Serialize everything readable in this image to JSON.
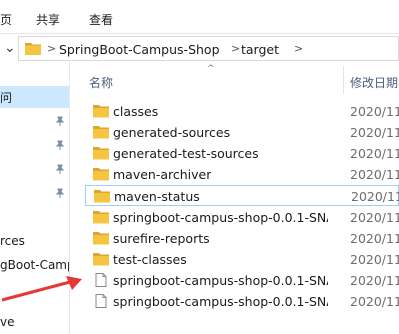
{
  "ribbon": {
    "tabs": [
      "页",
      "共享",
      "查看"
    ]
  },
  "address": {
    "crumbs": [
      "SpringBoot-Campus-Shop",
      "target"
    ]
  },
  "columns": {
    "name": "名称",
    "date": "修改日期"
  },
  "nav": {
    "items": [
      {
        "label": "问",
        "selected": true
      },
      {
        "label": "rces",
        "selected": false
      },
      {
        "label": "gBoot-Camp",
        "selected": false
      },
      {
        "label": "ve",
        "selected": false
      }
    ]
  },
  "files": [
    {
      "name": "classes",
      "date": "2020/11/",
      "type": "folder"
    },
    {
      "name": "generated-sources",
      "date": "2020/11/",
      "type": "folder"
    },
    {
      "name": "generated-test-sources",
      "date": "2020/11/",
      "type": "folder"
    },
    {
      "name": "maven-archiver",
      "date": "2020/11/",
      "type": "folder"
    },
    {
      "name": "maven-status",
      "date": "2020/11/",
      "type": "folder"
    },
    {
      "name": "springboot-campus-shop-0.0.1-SNA...",
      "date": "2020/11/",
      "type": "folder"
    },
    {
      "name": "surefire-reports",
      "date": "2020/11/",
      "type": "folder"
    },
    {
      "name": "test-classes",
      "date": "2020/11/",
      "type": "folder"
    },
    {
      "name": "springboot-campus-shop-0.0.1-SNA...",
      "date": "2020/11/",
      "type": "file"
    },
    {
      "name": "springboot-campus-shop-0.0.1-SNA...",
      "date": "2020/11/",
      "type": "file"
    }
  ],
  "colors": {
    "folder": "#f5c542",
    "folder_dark": "#dca631",
    "accent": "#cce8ff",
    "annotation_arrow": "#e53935"
  }
}
